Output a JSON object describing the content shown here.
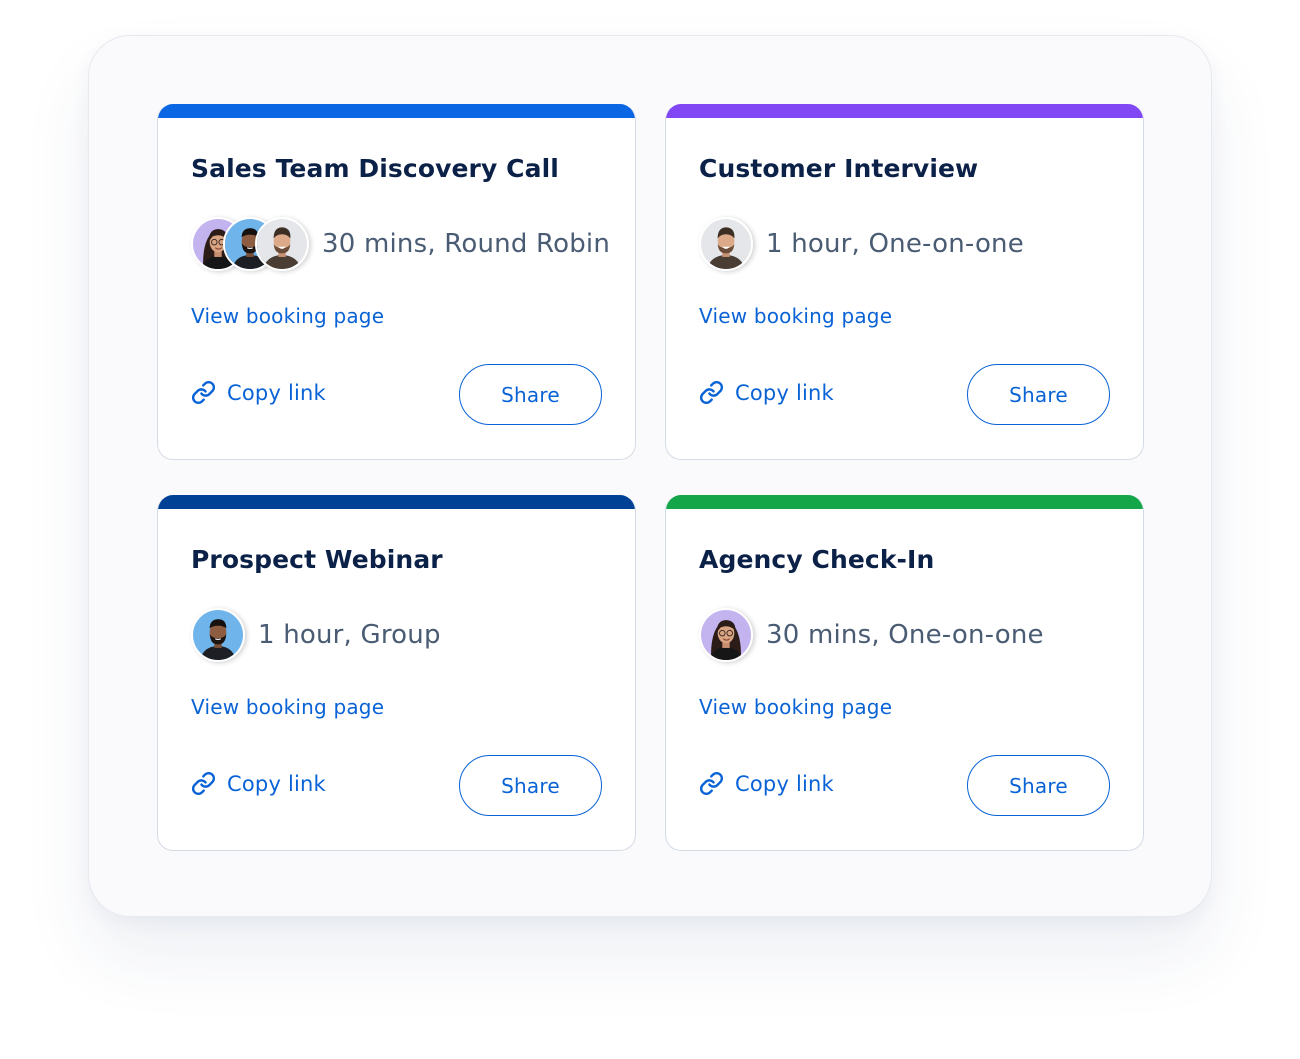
{
  "cards": [
    {
      "title": "Sales Team Discovery Call",
      "meta": "30 mins, Round Robin",
      "accent_color": "#0b66e4",
      "avatars": [
        "woman-with-glasses-avatar",
        "man-with-beard-avatar",
        "smiling-man-avatar"
      ],
      "booking_link": "View booking page",
      "copy_link": "Copy link",
      "share": "Share"
    },
    {
      "title": "Customer Interview",
      "meta": "1 hour, One-on-one",
      "accent_color": "#8247f5",
      "avatars": [
        "smiling-man-avatar"
      ],
      "booking_link": "View booking page",
      "copy_link": "Copy link",
      "share": "Share"
    },
    {
      "title": "Prospect Webinar",
      "meta": "1 hour, Group",
      "accent_color": "#004196",
      "avatars": [
        "man-with-beard-avatar"
      ],
      "booking_link": "View booking page",
      "copy_link": "Copy link",
      "share": "Share"
    },
    {
      "title": "Agency Check-In",
      "meta": "30 mins, One-on-one",
      "accent_color": "#15a64a",
      "avatars": [
        "woman-with-glasses-avatar"
      ],
      "booking_link": "View booking page",
      "copy_link": "Copy link",
      "share": "Share"
    }
  ],
  "link_color": "#0a63d6",
  "title_color": "#0b2147"
}
